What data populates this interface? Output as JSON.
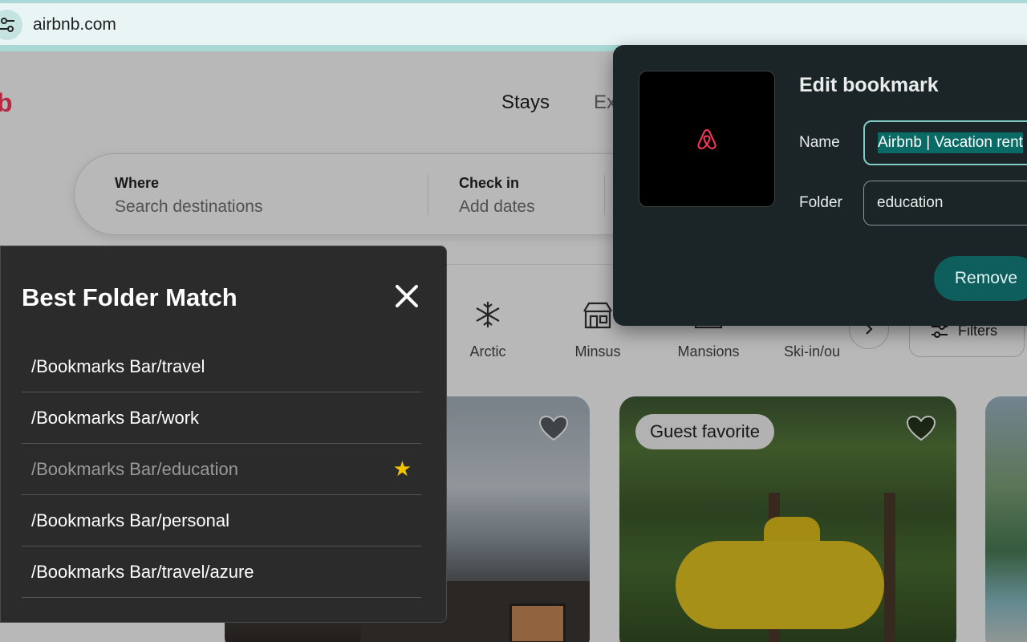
{
  "browser": {
    "url": "airbnb.com",
    "site_icon": "tune-icon"
  },
  "airbnb": {
    "logo_fragment": "b",
    "tabs": [
      "Stays",
      "Ex"
    ],
    "search": {
      "where_label": "Where",
      "where_placeholder": "Search destinations",
      "checkin_label": "Check in",
      "checkin_placeholder": "Add dates"
    },
    "categories": [
      {
        "label": "Arctic",
        "icon": "snowflake-icon"
      },
      {
        "label": "Minsus",
        "icon": "house-icon"
      },
      {
        "label": "Mansions",
        "icon": "mansion-icon"
      },
      {
        "label": "Ski-in/ou",
        "icon": "ski-icon"
      }
    ],
    "filters_label": "Filters",
    "listings": [
      {
        "badge": ""
      },
      {
        "badge": "Guest favorite"
      },
      {
        "badge": ""
      }
    ]
  },
  "folder_panel": {
    "title": "Best Folder Match",
    "items": [
      {
        "path": "/Bookmarks Bar/travel",
        "selected": false
      },
      {
        "path": "/Bookmarks Bar/work",
        "selected": false
      },
      {
        "path": "/Bookmarks Bar/education",
        "selected": true
      },
      {
        "path": "/Bookmarks Bar/personal",
        "selected": false
      },
      {
        "path": "/Bookmarks Bar/travel/azure",
        "selected": false
      }
    ],
    "star_glyph": "★"
  },
  "bookmark_dialog": {
    "title": "Edit bookmark",
    "name_label": "Name",
    "name_value": "Airbnb | Vacation rent",
    "folder_label": "Folder",
    "folder_value": "education",
    "remove_label": "Remove"
  },
  "colors": {
    "airbnb_brand": "#ff385c",
    "dialog_bg": "#1b2426",
    "panel_bg": "#2b2b2b",
    "accent_teal": "#80cbc4",
    "star_yellow": "#f5c400"
  }
}
